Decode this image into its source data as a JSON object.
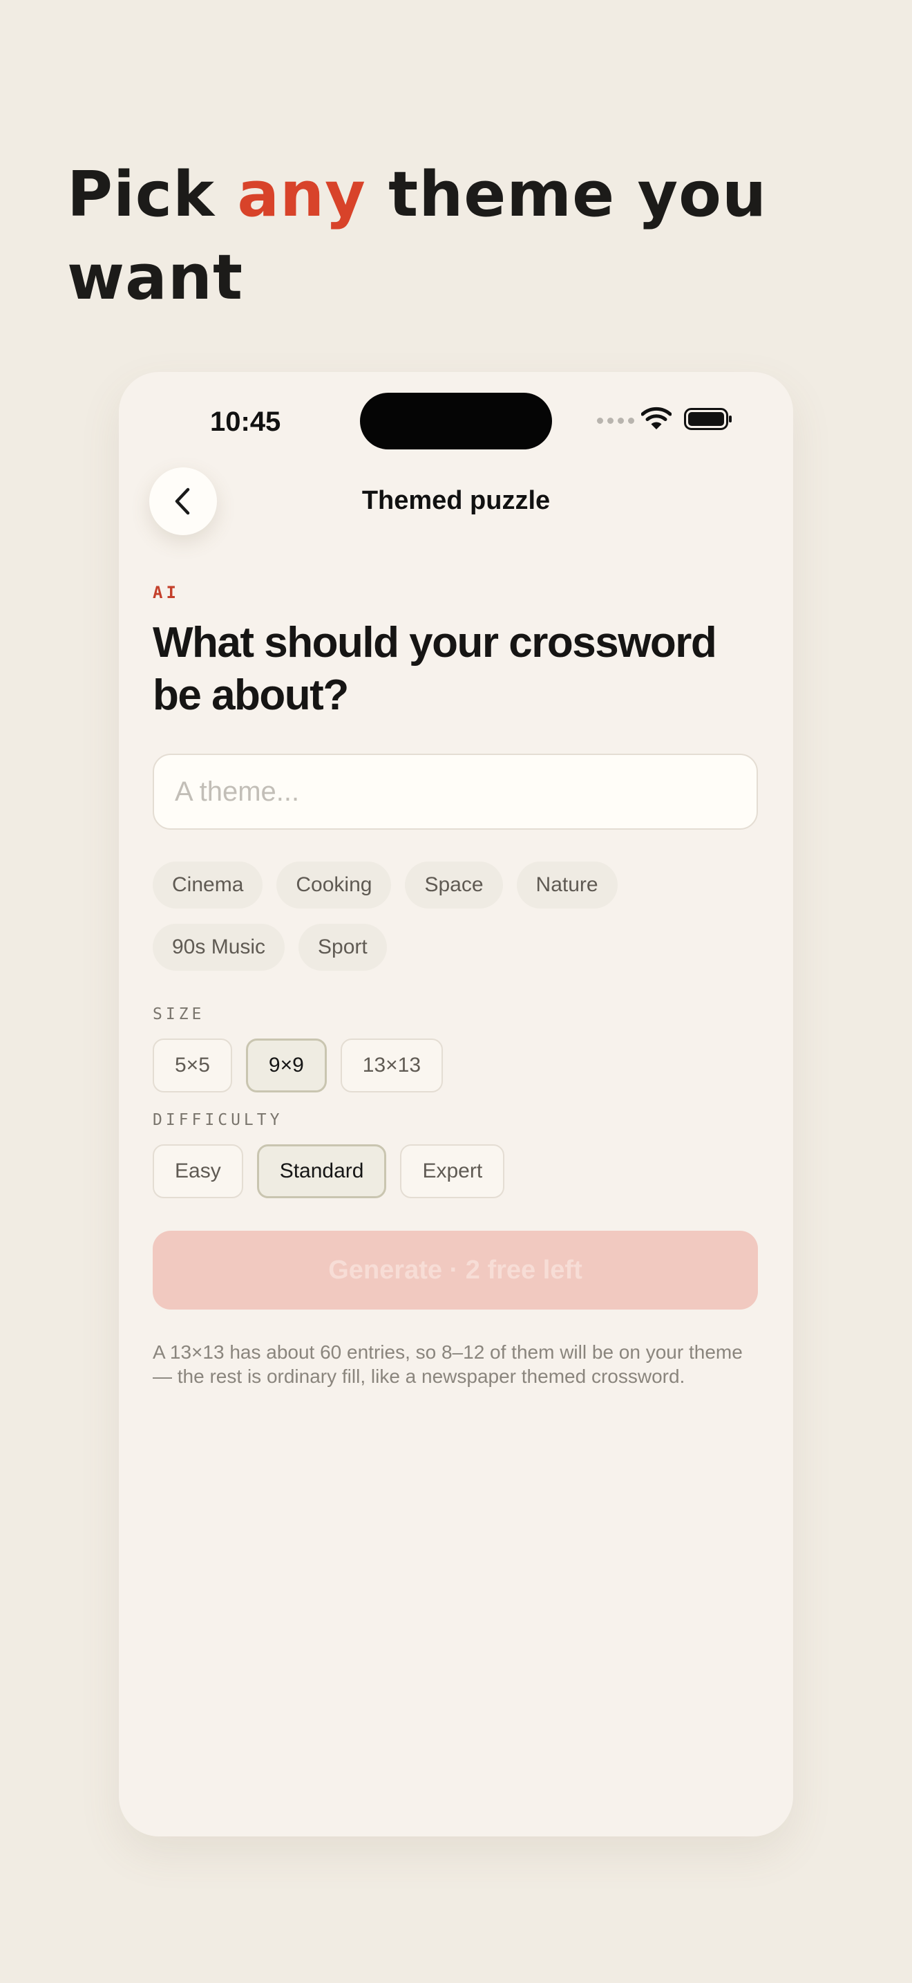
{
  "headline": {
    "before": "Pick ",
    "accent": "any",
    "after": " theme you want"
  },
  "status_bar": {
    "time": "10:45"
  },
  "nav": {
    "title": "Themed puzzle"
  },
  "form": {
    "ai_tag": "AI",
    "question": "What should your crossword be about?",
    "theme_input": {
      "value": "",
      "placeholder": "A theme..."
    },
    "suggestions": [
      "Cinema",
      "Cooking",
      "Space",
      "Nature",
      "90s Music",
      "Sport"
    ],
    "size": {
      "label": "SIZE",
      "options": [
        "5×5",
        "9×9",
        "13×13"
      ],
      "selected": "9×9"
    },
    "difficulty": {
      "label": "DIFFICULTY",
      "options": [
        "Easy",
        "Standard",
        "Expert"
      ],
      "selected": "Standard"
    },
    "generate_label": "Generate · 2 free left",
    "note": "A 13×13 has about 60 entries, so 8–12 of them will be on your theme — the rest is ordinary fill, like a newspaper themed crossword."
  },
  "colors": {
    "accent": "#d8432a",
    "background": "#f1ece3",
    "card": "#f7f2ec",
    "generate_disabled": "#f1c9c0"
  }
}
